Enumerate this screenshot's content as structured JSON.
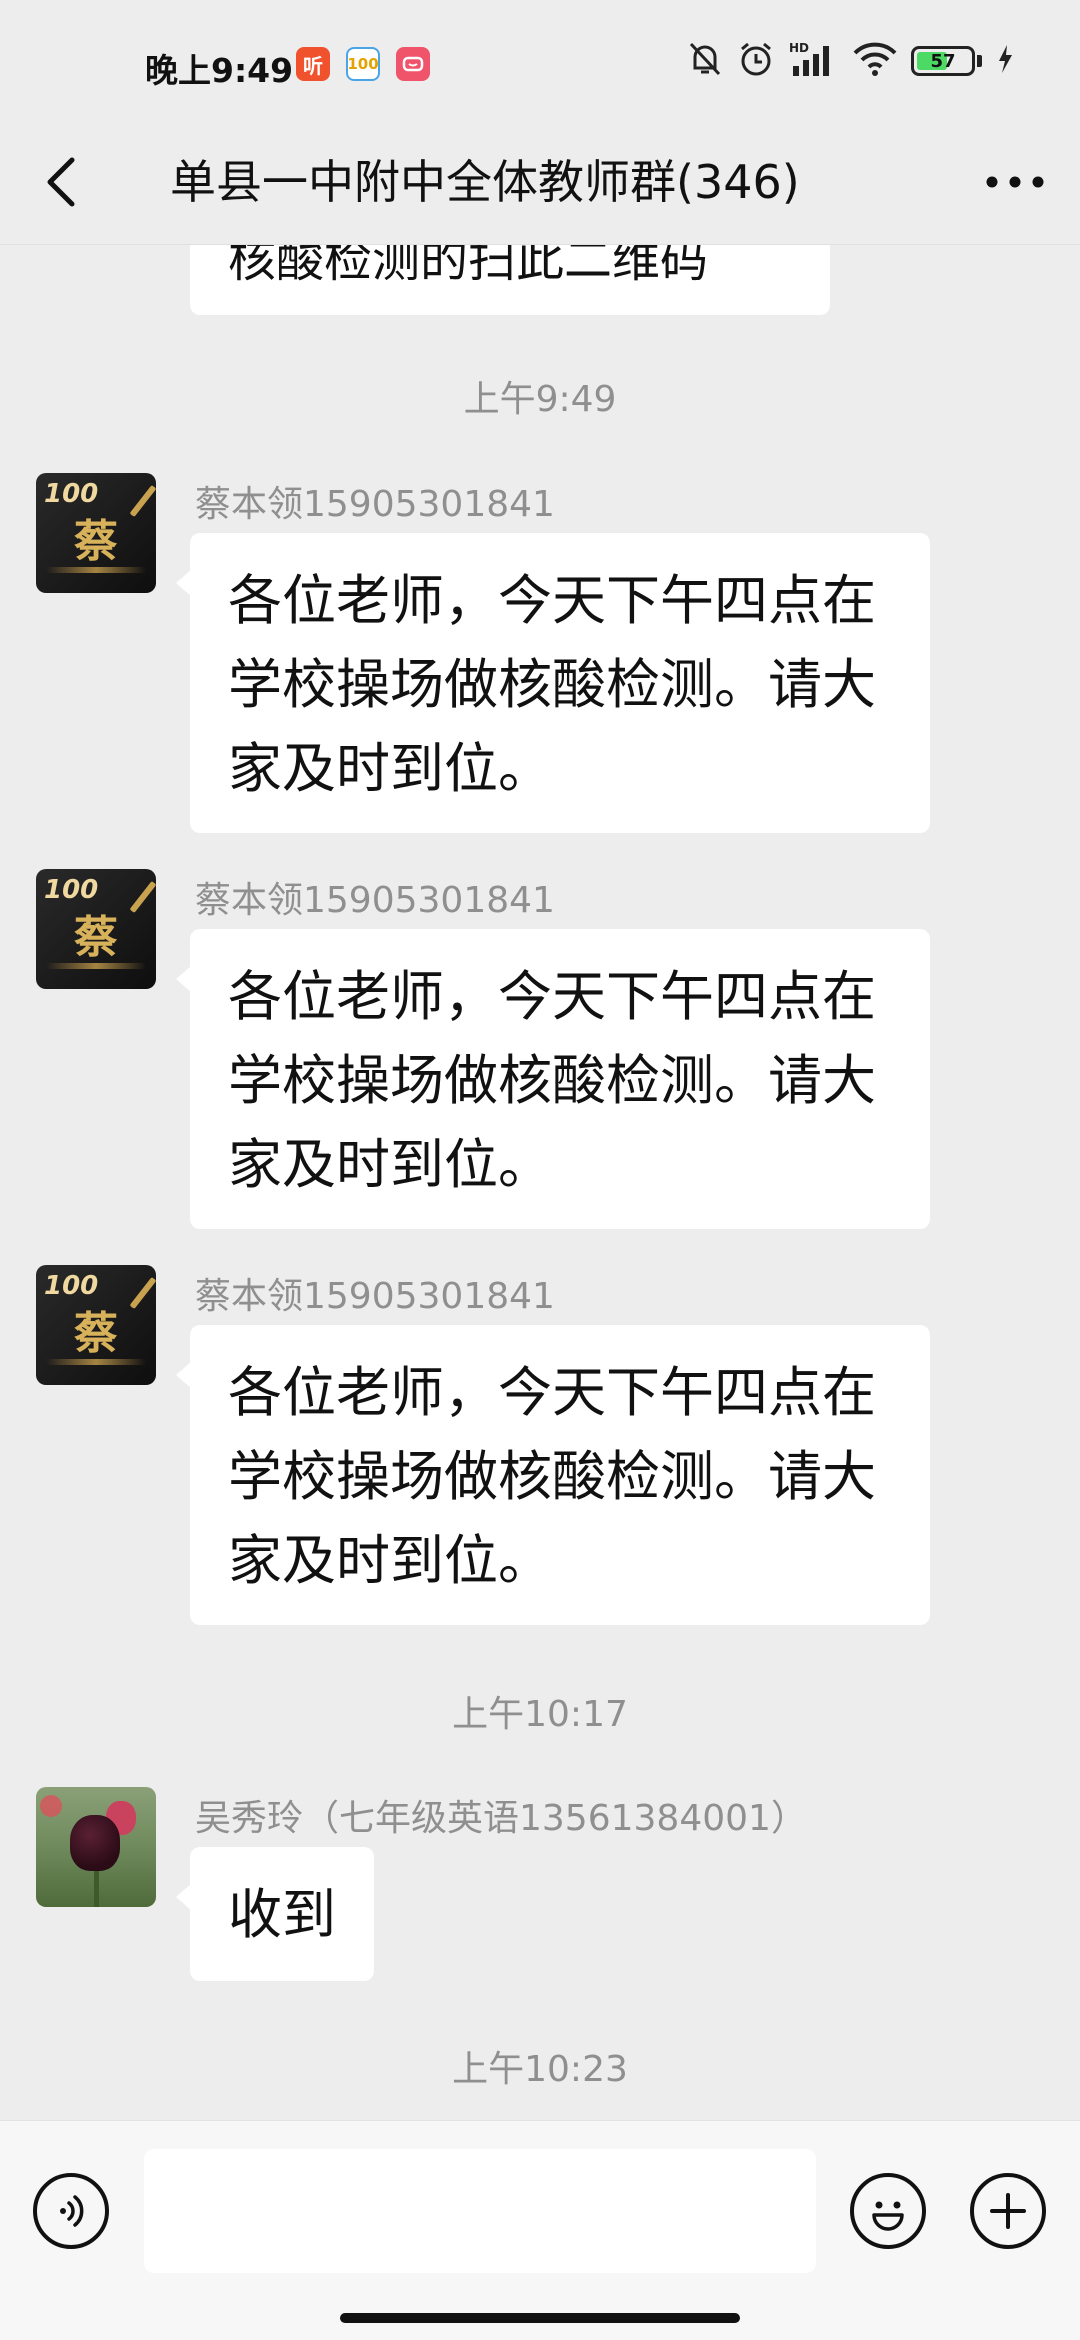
{
  "status_bar": {
    "time": "晚上9:49",
    "app_icons": [
      {
        "name": "ting-app-icon",
        "label": "听",
        "color": "#f0522e"
      },
      {
        "name": "100-app-icon",
        "label": "100",
        "color": "#49a5e6"
      },
      {
        "name": "red-app-icon",
        "label": "",
        "color": "#f0546a"
      }
    ],
    "battery_level": "57",
    "battery_fraction": 0.57,
    "icons": [
      "mute-bell-icon",
      "alarm-icon",
      "hd-signal-icon",
      "wifi-icon",
      "battery-icon",
      "charging-icon"
    ]
  },
  "header": {
    "title": "单县一中附中全体教师群(346)",
    "back_icon": "chevron-left-icon",
    "more_icon": "more-dots-icon"
  },
  "messages": {
    "partial_top": "核酸检测的扫此二维码",
    "time_1": "上午9:49",
    "items": [
      {
        "sender": "蔡本领15905301841",
        "avatar_char": "蔡",
        "avatar_badge": "100",
        "text": "各位老师，今天下午四点在学校操场做核酸检测。请大家及时到位。"
      },
      {
        "sender": "蔡本领15905301841",
        "avatar_char": "蔡",
        "avatar_badge": "100",
        "text": "各位老师，今天下午四点在学校操场做核酸检测。请大家及时到位。"
      },
      {
        "sender": "蔡本领15905301841",
        "avatar_char": "蔡",
        "avatar_badge": "100",
        "text": "各位老师，今天下午四点在学校操场做核酸检测。请大家及时到位。"
      }
    ],
    "time_2": "上午10:17",
    "reply": {
      "sender": "吴秀玲（七年级英语13561384001）",
      "text": "收到"
    },
    "time_3": "上午10:23"
  },
  "input_bar": {
    "placeholder": "",
    "voice_icon": "voice-icon",
    "emoji_icon": "emoji-icon",
    "add_icon": "plus-icon"
  }
}
